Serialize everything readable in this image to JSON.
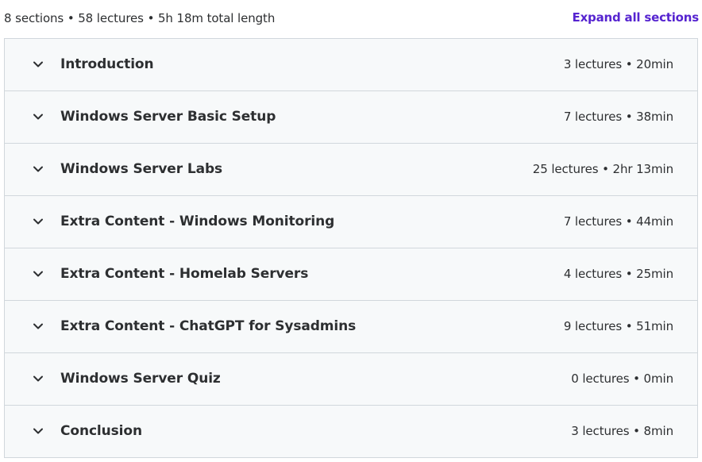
{
  "summary": {
    "text": "8 sections • 58 lectures • 5h 18m total length",
    "expand_label": "Expand all sections"
  },
  "sections": [
    {
      "title": "Introduction",
      "meta": "3 lectures • 20min",
      "icon": "chevron-down-icon"
    },
    {
      "title": "Windows Server Basic Setup",
      "meta": "7 lectures • 38min",
      "icon": "chevron-down-icon"
    },
    {
      "title": "Windows Server Labs",
      "meta": "25 lectures • 2hr 13min",
      "icon": "chevron-down-icon"
    },
    {
      "title": "Extra Content - Windows Monitoring",
      "meta": "7 lectures • 44min",
      "icon": "chevron-down-icon"
    },
    {
      "title": "Extra Content - Homelab Servers",
      "meta": "4 lectures • 25min",
      "icon": "chevron-down-icon"
    },
    {
      "title": "Extra Content - ChatGPT for Sysadmins",
      "meta": "9 lectures • 51min",
      "icon": "chevron-down-icon"
    },
    {
      "title": "Windows Server Quiz",
      "meta": "0 lectures • 0min",
      "icon": "chevron-down-icon"
    },
    {
      "title": "Conclusion",
      "meta": "3 lectures • 8min",
      "icon": "chevron-down-icon"
    }
  ],
  "colors": {
    "accent": "#5624d0",
    "row_background": "#f7f9fa",
    "border": "#d1d7dc",
    "text": "#2d2f31"
  }
}
